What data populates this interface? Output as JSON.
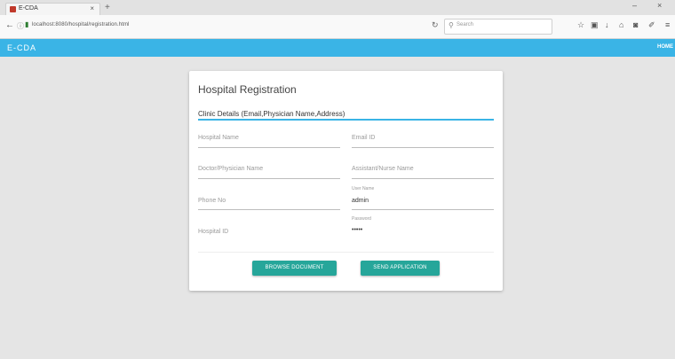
{
  "browser": {
    "tab_title": "E-CDA",
    "tab_close": "×",
    "new_tab": "+",
    "url": "localhost:8080/hospital/registration.html",
    "search_placeholder": "Search",
    "window_controls": [
      "–",
      "×"
    ]
  },
  "app": {
    "brand": "E-CDA",
    "nav_home": "HOME"
  },
  "form": {
    "title": "Hospital Registration",
    "section_label": "Clinic Details (Email,Physician Name,Address)",
    "fields": {
      "hospital_name": {
        "placeholder": "Hospital Name"
      },
      "email_id": {
        "placeholder": "Email ID"
      },
      "doctor_name": {
        "placeholder": "Doctor/Physician Name"
      },
      "assistant_name": {
        "placeholder": "Assistant/Nurse Name"
      },
      "phone_no": {
        "placeholder": "Phone No"
      },
      "user_name": {
        "label": "User Name",
        "value": "admin"
      },
      "hospital_id": {
        "placeholder": "Hospital ID"
      },
      "password": {
        "label": "Password",
        "value": "•••••"
      }
    },
    "buttons": {
      "browse": "BROWSE DOCUMENT",
      "send": "SEND APPLICATION"
    }
  }
}
